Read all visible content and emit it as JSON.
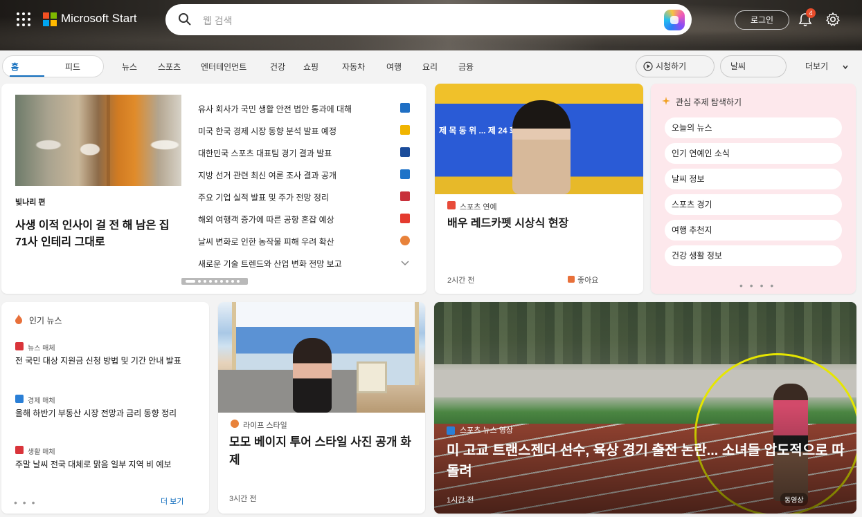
{
  "header": {
    "brand": "Microsoft Start",
    "search_placeholder": "웹 검색",
    "login_label": "로그인",
    "notification_count": "4"
  },
  "nav": {
    "tabs": [
      "홈",
      "피드",
      "뉴스",
      "스포츠",
      "엔터테인먼트",
      "건강",
      "쇼핑",
      "자동차",
      "여행",
      "요리",
      "금융"
    ],
    "active_tab_index": 0,
    "right_pills": [
      "시청하기",
      "날씨",
      "더보기"
    ]
  },
  "card_headlines": {
    "hero_source": "빛나리 편",
    "hero_title": "사생 이적 인사이 걸 전 해 남은 집 71사 인테리 그대로",
    "items": [
      {
        "text": "유사 회사가 국민 생활 안전 법안 통과에 대해",
        "logo_color": "#1f6fc4"
      },
      {
        "text": "미국 한국 경제 시장 동향 분석 발표 예정",
        "logo_color": "#f0b400"
      },
      {
        "text": "대한민국 스포츠 대표팀 경기 결과 발표",
        "logo_color": "#1b4c9a"
      },
      {
        "text": "지방 선거 관련 최신 여론 조사 결과 공개",
        "logo_color": "#1e73c8"
      },
      {
        "text": "주요 기업 실적 발표 및 주가 전망 정리",
        "logo_color": "#c8313b"
      },
      {
        "text": "해외 여행객 증가에 따른 공항 혼잡 예상",
        "logo_color": "#e43b2f"
      },
      {
        "text": "날씨 변화로 인한 농작물 피해 우려 확산",
        "logo_color": "#e8823a"
      },
      {
        "text": "새로운 기술 트렌드와 산업 변화 전망 보고",
        "logo_color": "#9a9a9a"
      }
    ]
  },
  "card_star": {
    "banner_text": "제 목 동 위 ... 제 24 회",
    "source": "스포츠 연예",
    "title": "배우 레드카펫 시상식 현장",
    "time": "2시간 전",
    "reactions": "좋아요"
  },
  "card_topics": {
    "title": "관심 주제 탐색하기",
    "chips": [
      "오늘의 뉴스",
      "인기 연예인 소식",
      "날씨 정보",
      "스포츠 경기",
      "여행 추천지",
      "건강 생활 정보"
    ]
  },
  "card_trending": {
    "title": "인기 뉴스",
    "items": [
      {
        "source": "뉴스 매체",
        "title": "전 국민 대상 지원금 신청 방법 및 기간 안내 발표",
        "color": "#d9343a"
      },
      {
        "source": "경제 매체",
        "title": "올해 하반기 부동산 시장 전망과 금리 동향 정리",
        "color": "#2a7fd6"
      },
      {
        "source": "생활 매체",
        "title": "주말 날씨 전국 대체로 맑음 일부 지역 비 예보",
        "color": "#d9343a"
      }
    ],
    "more": "더 보기"
  },
  "card_lifestyle": {
    "source": "라이프 스타일",
    "title": "모모 베이지 투어 스타일 사진 공개 화제",
    "time": "3시간 전"
  },
  "card_video": {
    "source": "스포츠 뉴스 영상",
    "title": "미 고교 트랜스젠더 선수, 육상 경기 출전 논란... 소녀들 압도적으로 따돌려",
    "time": "1시간 전",
    "badge": "동영상"
  },
  "colors": {
    "accent": "#0f6cbd",
    "ms_red": "#f25022",
    "ms_green": "#7fba00",
    "ms_blue": "#00a4ef",
    "ms_yellow": "#ffb900"
  }
}
